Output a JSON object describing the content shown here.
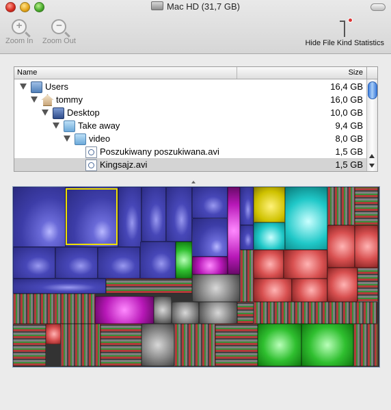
{
  "window": {
    "title": "Mac HD (31,7 GB)"
  },
  "toolbar": {
    "zoom_in_label": "Zoom In",
    "zoom_out_label": "Zoom Out",
    "hide_stats_label": "Hide File Kind Statistics"
  },
  "list": {
    "columns": {
      "name": "Name",
      "size": "Size"
    },
    "rows": [
      {
        "name": "Users",
        "size": "16,4 GB"
      },
      {
        "name": "tommy",
        "size": "16,0 GB"
      },
      {
        "name": "Desktop",
        "size": "10,0 GB"
      },
      {
        "name": "Take away",
        "size": "9,4 GB"
      },
      {
        "name": "video",
        "size": "8,0 GB"
      },
      {
        "name": "Poszukiwany poszukiwana.avi",
        "size": "1,5 GB"
      },
      {
        "name": "Kingsajz.avi",
        "size": "1,5 GB"
      }
    ]
  },
  "colors": {
    "selected_row": "#d4d4d4",
    "treemap_highlight": "#f0e000"
  }
}
